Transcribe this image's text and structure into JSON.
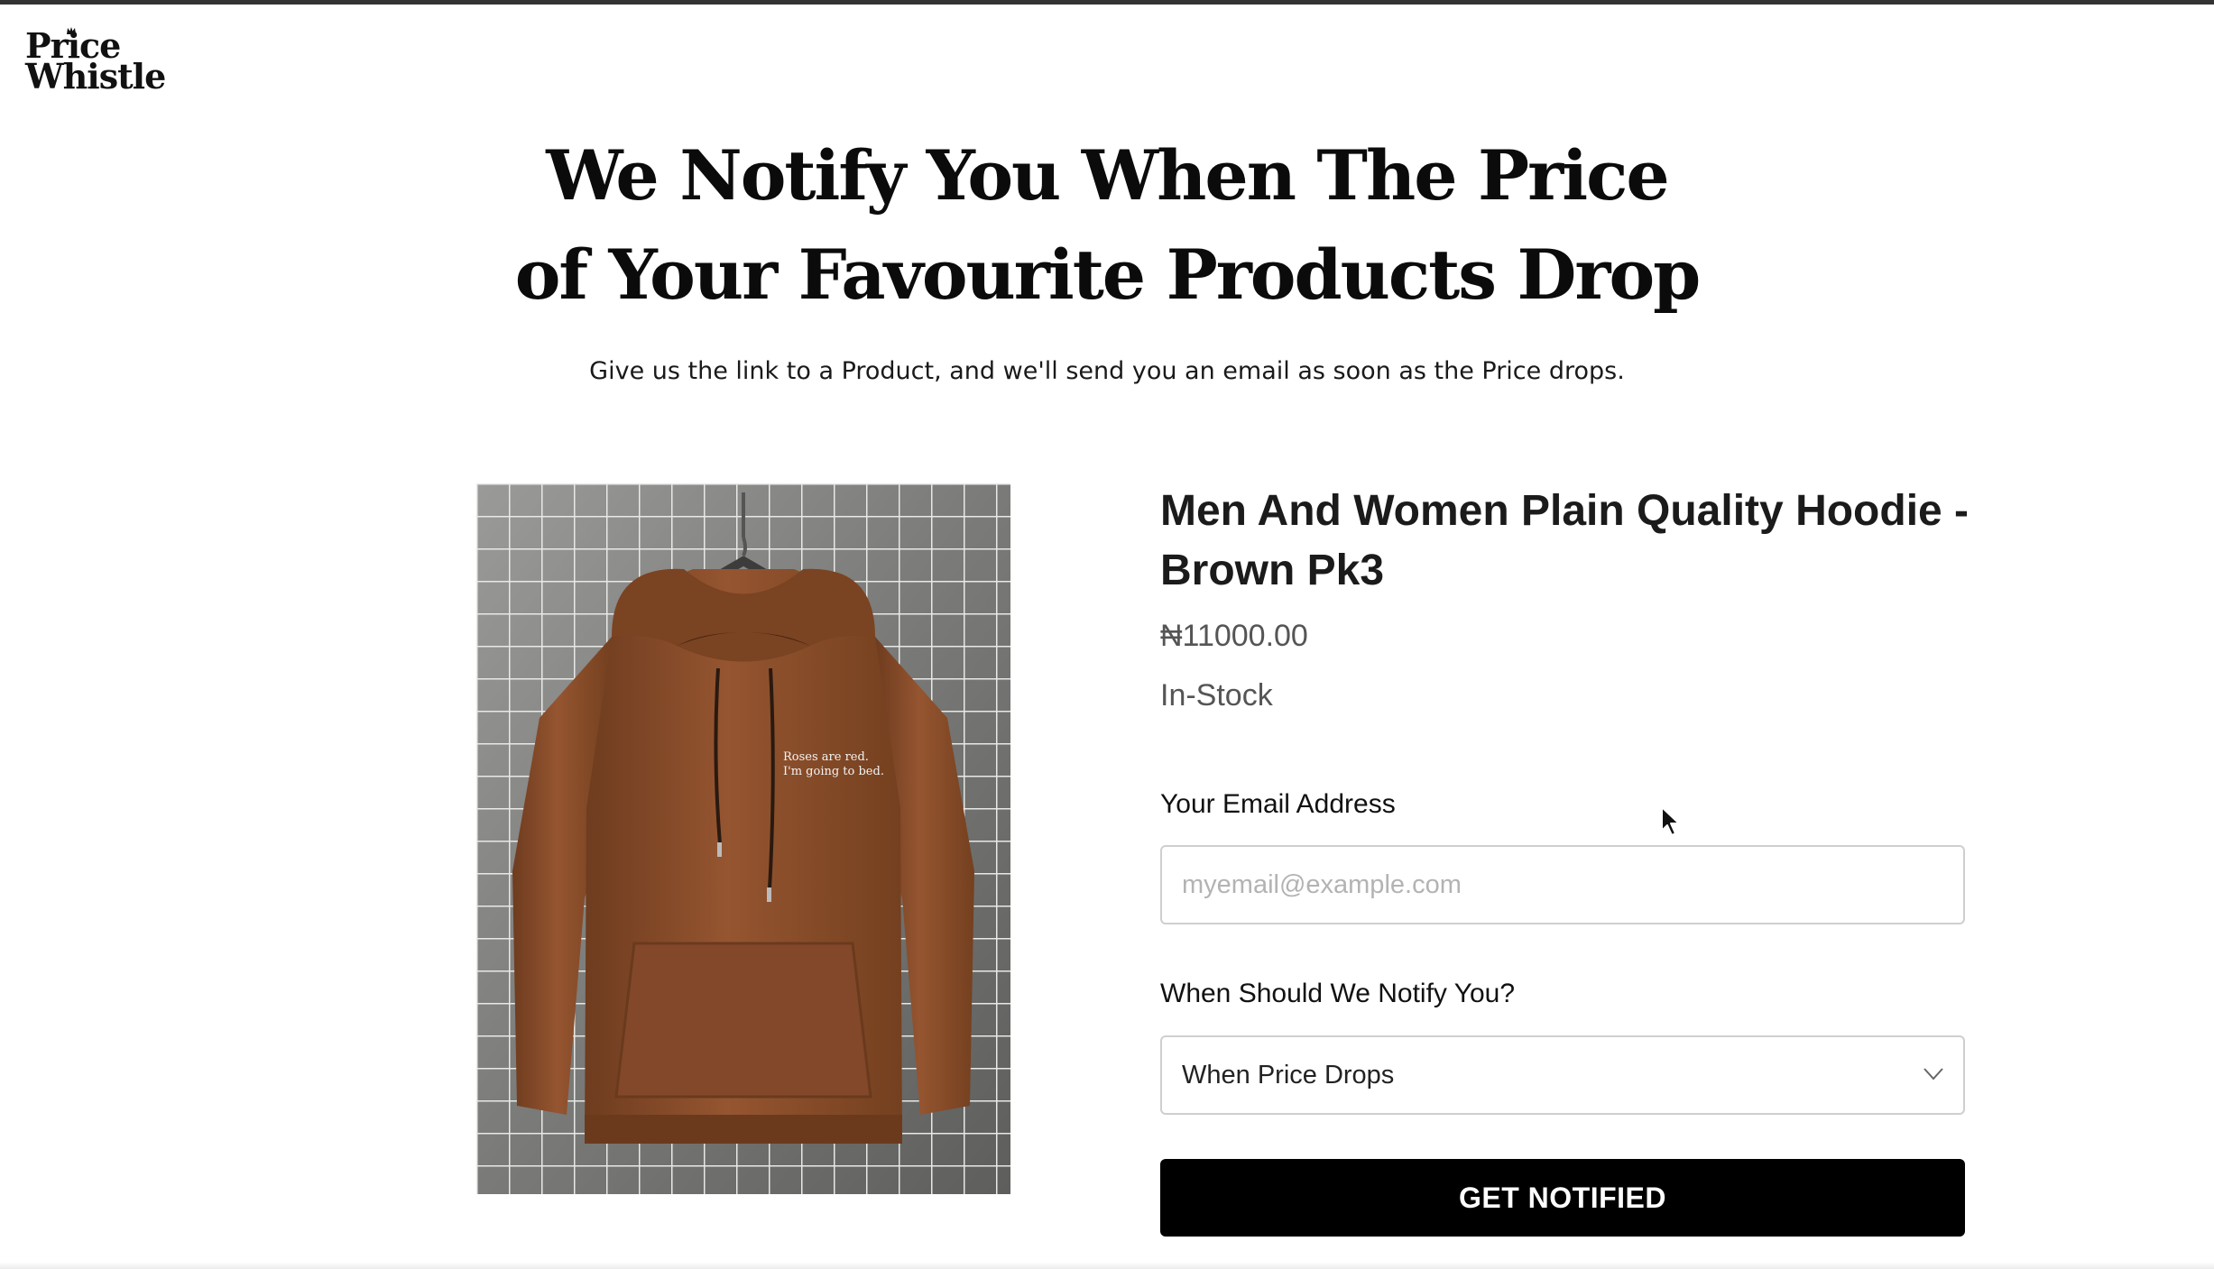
{
  "brand": {
    "logo_line1": "Price",
    "logo_line2": "Whistle"
  },
  "hero": {
    "title_line1": "We Notify You When The Price",
    "title_line2": "of Your Favourite Products Drop",
    "subtitle": "Give us the link to a Product, and we'll send you an email as soon as the Price drops."
  },
  "product": {
    "image_print_line1": "Roses are red.",
    "image_print_line2": "I'm going to bed.",
    "title": "Men And Women Plain Quality Hoodie - Brown Pk3",
    "price": "₦11000.00",
    "stock": "In-Stock"
  },
  "form": {
    "email_label": "Your Email Address",
    "email_placeholder": "myemail@example.com",
    "email_value": "",
    "notify_label": "When Should We Notify You?",
    "notify_selected": "When Price Drops",
    "submit_label": "GET NOTIFIED"
  },
  "colors": {
    "hoodie": "#8a4f2a",
    "button_bg": "#000000",
    "button_text": "#ffffff",
    "muted_text": "#555555"
  },
  "icons": {
    "select": "chevron-down-icon",
    "pointer": "mouse-cursor-icon"
  }
}
